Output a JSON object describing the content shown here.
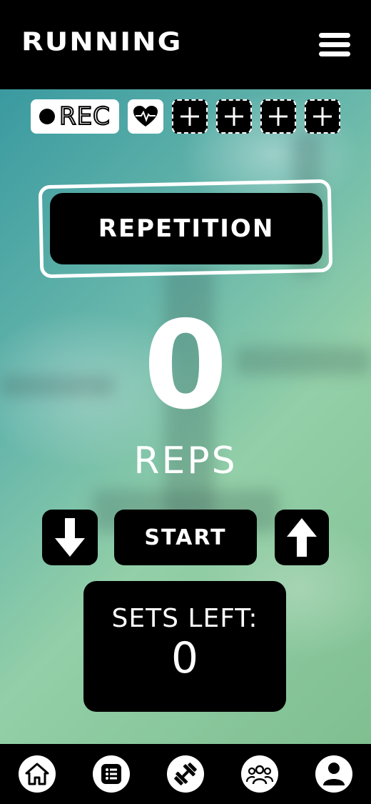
{
  "header": {
    "title": "RUNNING",
    "menu_icon": "hamburger-menu-icon"
  },
  "toolbar": {
    "record_label": "REC",
    "record_icon": "record-dot-icon",
    "heart_icon": "heart-rate-icon",
    "add_slots": [
      {
        "icon": "plus-icon"
      },
      {
        "icon": "plus-icon"
      },
      {
        "icon": "plus-icon"
      },
      {
        "icon": "plus-icon"
      }
    ]
  },
  "mode": {
    "label": "REPETITION"
  },
  "counter": {
    "value": "0",
    "unit": "REPS"
  },
  "controls": {
    "decrease_icon": "arrow-down-icon",
    "start_label": "START",
    "increase_icon": "arrow-up-icon"
  },
  "sets": {
    "label": "SETS LEFT:",
    "value": "0"
  },
  "bottom_nav": {
    "items": [
      {
        "icon": "home-icon"
      },
      {
        "icon": "list-icon"
      },
      {
        "icon": "dumbbell-icon"
      },
      {
        "icon": "group-icon"
      },
      {
        "icon": "profile-icon"
      }
    ]
  },
  "colors": {
    "background_top": "#3a9aa0",
    "background_bottom": "#93cfa8",
    "surface": "#000000",
    "text": "#ffffff"
  }
}
